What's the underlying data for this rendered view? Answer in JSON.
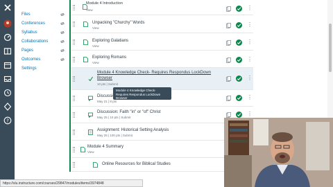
{
  "global_nav": {
    "icons": [
      "logo-icon",
      "account-icon",
      "dashboard-icon",
      "courses-icon",
      "calendar-icon",
      "inbox-icon",
      "history-icon",
      "commons-icon",
      "help-icon"
    ]
  },
  "course_nav": {
    "items": [
      {
        "label": "Files"
      },
      {
        "label": "Conferences"
      },
      {
        "label": "Syllabus"
      },
      {
        "label": "Collaborations"
      },
      {
        "label": "Pages"
      },
      {
        "label": "Outcomes"
      },
      {
        "label": "Settings"
      }
    ]
  },
  "modules": {
    "items": [
      {
        "title": "Module 4 Introduction",
        "sub": "View",
        "type": "page"
      },
      {
        "title": "Unpacking \"Churchy\" Words",
        "sub": "View",
        "type": "page"
      },
      {
        "title": "Exploring Galatians",
        "sub": "View",
        "type": "page"
      },
      {
        "title": "Exploring Romans",
        "sub": "View",
        "type": "page"
      },
      {
        "title_line1": "Module 4 Knowledge Check- Requires Respondus LockDown",
        "title_line2": "Browser",
        "sub": "10 pts | Submit",
        "type": "quiz"
      },
      {
        "title": "Discussion: ...ce Faith Not Protest!",
        "sub": "May 21 | 8 pts",
        "type": "discussion"
      },
      {
        "title": "Discussion: Faith \"in\" or \"of\" Christ",
        "sub": "May 25 | 10 pts | Submit",
        "type": "discussion"
      },
      {
        "title": "Assignment: Historical Setting Analysis",
        "sub": "May 25 | 100 pts | Submit",
        "type": "assignment"
      },
      {
        "title": "Module 4 Summary",
        "sub": "View",
        "type": "page"
      },
      {
        "title": "Online Resources for Biblical Studies",
        "sub": "",
        "type": "page"
      }
    ]
  },
  "tooltip": {
    "text": "Module 4 Knowledge Check- Requires Respondus LockDown Browser"
  },
  "statusbar": {
    "url": "https://slu.instructure.com/courses/29847/modules/items/3974848"
  },
  "colors": {
    "global_nav": "#394b58",
    "accent": "#0374b5",
    "published": "#0b874b",
    "highlight": "#e8f0f5"
  }
}
